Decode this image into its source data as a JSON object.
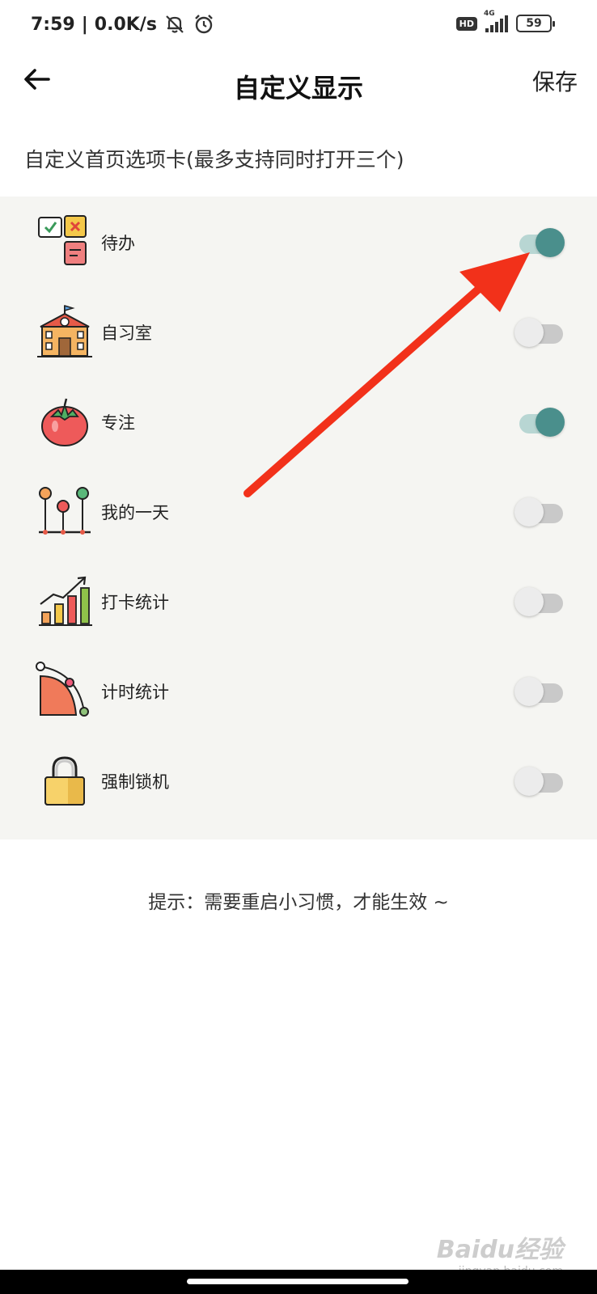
{
  "status_bar": {
    "time": "7:59",
    "net_speed": "0.0K/s",
    "hd_badge": "HD",
    "network": "4G",
    "battery": "59",
    "icons": [
      "bell-off-icon",
      "alarm-icon",
      "signal-icon",
      "battery-icon"
    ]
  },
  "header": {
    "back_icon": "arrow-left-icon",
    "title": "自定义显示",
    "save_label": "保存"
  },
  "subtitle": "自定义首页选项卡(最多支持同时打开三个)",
  "items": [
    {
      "label": "待办",
      "icon": "todo-notes-icon",
      "enabled": true
    },
    {
      "label": "自习室",
      "icon": "school-building-icon",
      "enabled": false
    },
    {
      "label": "专注",
      "icon": "tomato-icon",
      "enabled": true
    },
    {
      "label": "我的一天",
      "icon": "timeline-icon",
      "enabled": false
    },
    {
      "label": "打卡统计",
      "icon": "bar-chart-icon",
      "enabled": false
    },
    {
      "label": "计时统计",
      "icon": "pie-curve-icon",
      "enabled": false
    },
    {
      "label": "强制锁机",
      "icon": "padlock-icon",
      "enabled": false
    }
  ],
  "hint": "提示：需要重启小习惯，才能生效 ~",
  "colors": {
    "toggle_on": "#4a8f8c",
    "toggle_on_track": "#b8d6d3",
    "toggle_off_track": "#c9c9c9",
    "panel_bg": "#f5f5f2",
    "annotation_arrow": "#f2311a"
  },
  "watermark": {
    "text": "Baidu经验",
    "sub": "jingyan.baidu.com"
  }
}
